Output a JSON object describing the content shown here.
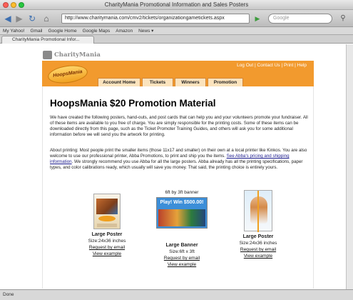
{
  "window": {
    "title": "CharityMania Promotional Information and Sales Posters",
    "lights": [
      "#ff5f57",
      "#ffbd2e",
      "#28c840"
    ]
  },
  "toolbar": {
    "back_icon": "arrow-left-icon",
    "forward_icon": "arrow-right-icon",
    "reload_icon": "reload-icon",
    "home_icon": "home-icon",
    "url": "http://www.charitymania.com/cmv2/tickets/organizationgametickets.aspx",
    "search_placeholder": "Google"
  },
  "bookmarks": [
    "My Yahoo!",
    "Gmail",
    "Google Home",
    "Google Maps",
    "Amazon",
    "News ▾"
  ],
  "tab": {
    "label": "CharityMania Promotional Infor..."
  },
  "site": {
    "logo_text": "CharityMania",
    "util_links": "Log Out | Contact Us | Print | Help",
    "hm_logo": "HoopsMania",
    "nav_tabs": [
      "Account Home",
      "Tickets",
      "Winners",
      "Promotion"
    ],
    "accent": "#f29a2e"
  },
  "content": {
    "title": "HoopsMania $20  Promotion Material",
    "paragraph1": "We have created the following posters, hand-outs, and post cards that can help you and your volunteers promote your fundraiser. All of these items are available to you free of charge. You are simply responsible for the printing costs. Some of these items can be downloaded directly from this page, such as the Ticket Promoter Training Guides, and others will ask you for some additional information before we will send you the artwork for printing.",
    "paragraph2_start": "About printing: Most people print the smaller items (those 11x17 and smaller) on their own at a local printer like Kinkos. You are also welcome to use our professional printer, Abba Promotions, to print and ship you the items. ",
    "paragraph2_link": "See Abba's pricing and shipping information",
    "paragraph2_end": ". We strongly recommend you use Abba for all the large posters. Abba already has all the printing specifications, paper types, and color calibrations ready, which usually will save you money. That said, the printing choice is entirely yours.",
    "products": [
      {
        "name": "Large Poster",
        "size": "Size:24x36 inches",
        "request": "Request by email",
        "view": "View example"
      },
      {
        "caption": "6ft by 3ft banner",
        "banner_text": "Play! Win $500.00!",
        "name": "Large Banner",
        "size": "Size:6ft x 3ft",
        "request": "Request by email",
        "view": "View example"
      },
      {
        "name": "Large Poster",
        "size": "Size:24x36 inches",
        "request": "Request by email",
        "view": "View example"
      }
    ]
  },
  "status": "Done"
}
